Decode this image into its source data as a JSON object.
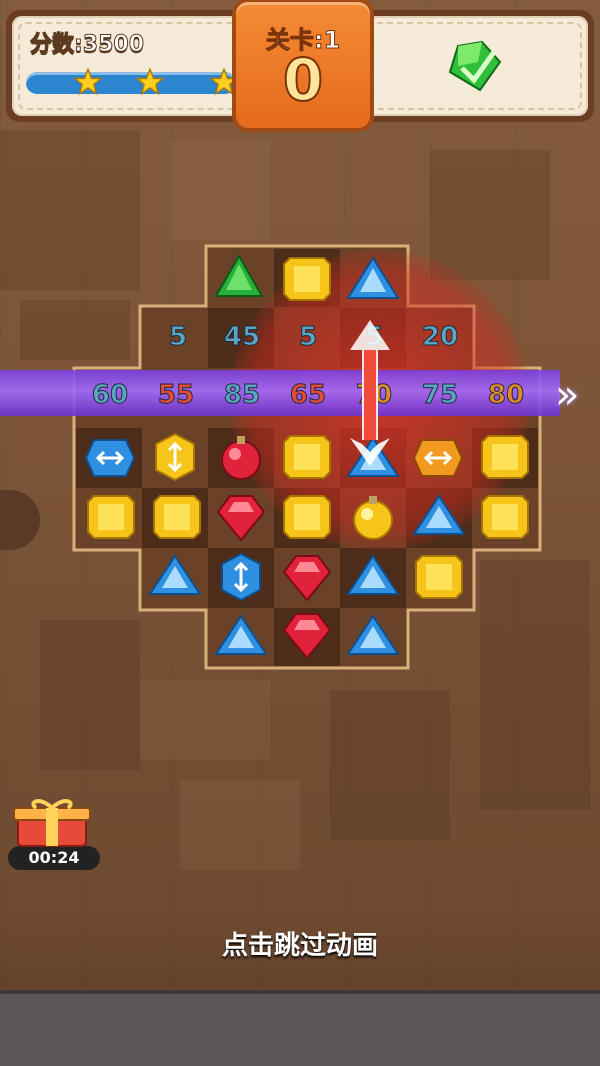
{
  "hud": {
    "score_label": "分数:3500",
    "stars_earned": 3,
    "stars_total": 3,
    "level_label": "关卡:1",
    "moves_left": "0",
    "target_icon": "green-gem-target-icon"
  },
  "board": {
    "row_scores": [
      "5",
      "45",
      "5",
      "5",
      "20"
    ],
    "combo_scores": [
      "60",
      "55",
      "85",
      "65",
      "70",
      "75",
      "80"
    ],
    "combo_colors": [
      "blue",
      "red",
      "blue",
      "red",
      "orange",
      "blue",
      "orange"
    ],
    "gems": [
      [
        "",
        "",
        "green-triangle",
        "yellow-square",
        "blue-triangle",
        "",
        ""
      ],
      [
        "",
        "",
        "",
        "",
        "",
        "",
        ""
      ],
      [
        "",
        "",
        "",
        "",
        "",
        "",
        ""
      ],
      [
        "blue-horizontal-striped",
        "yellow-vertical-striped",
        "red-bomb",
        "yellow-square",
        "blue-triangle",
        "orange-horizontal-striped",
        "yellow-square"
      ],
      [
        "yellow-square",
        "yellow-square",
        "red-gem",
        "yellow-square",
        "yellow-bomb",
        "blue-triangle",
        "yellow-square"
      ],
      [
        "",
        "blue-triangle",
        "blue-vertical-striped",
        "red-gem",
        "blue-triangle",
        "yellow-square",
        ""
      ],
      [
        "",
        "",
        "blue-triangle",
        "red-gem",
        "blue-triangle",
        "",
        ""
      ]
    ]
  },
  "bonus": {
    "timer": "00:24",
    "icon": "gift-box-icon"
  },
  "hint_text": "点击跳过动画",
  "colors": {
    "hud_bg": "#f6ead8",
    "level_bg": "#f48b35",
    "beam": "#a46cff"
  }
}
